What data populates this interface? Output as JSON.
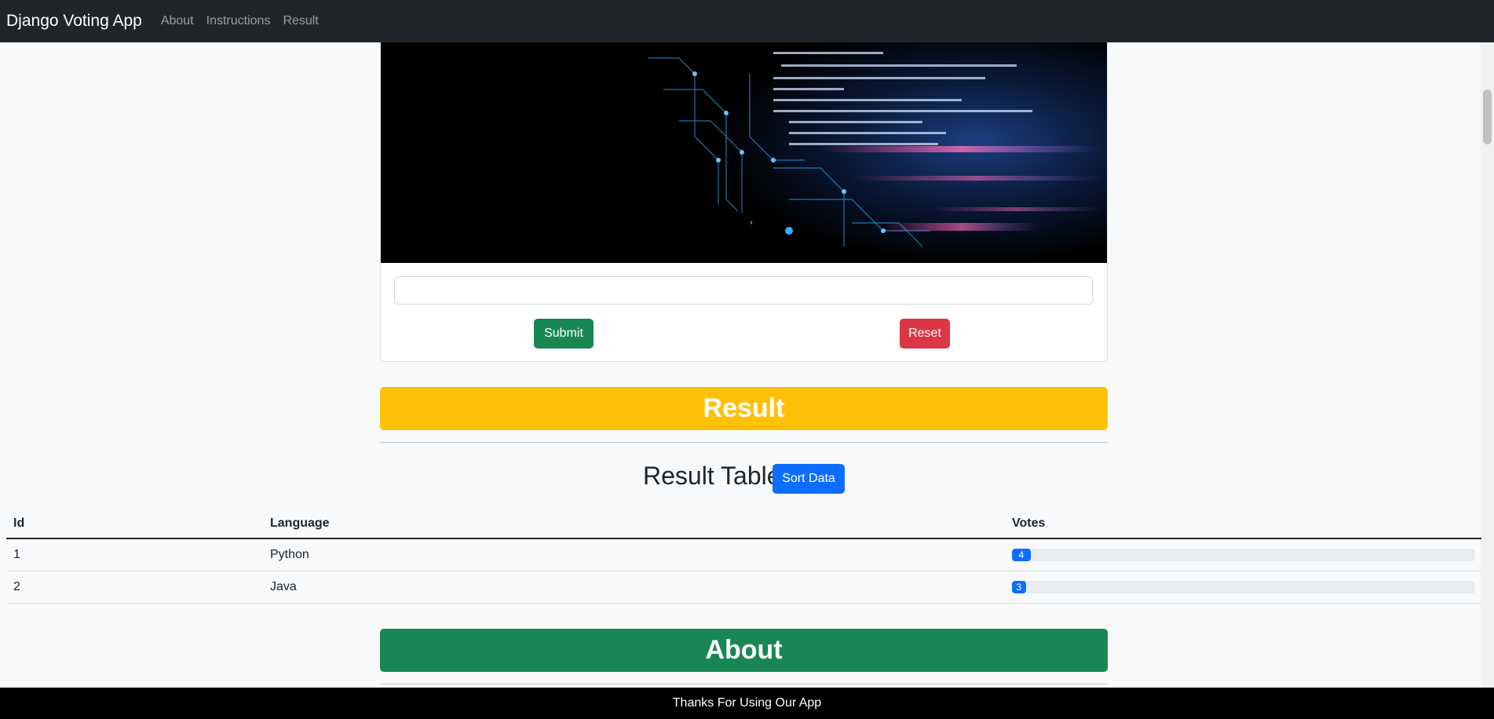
{
  "navbar": {
    "brand": "Django Voting App",
    "links": [
      "About",
      "Instructions",
      "Result"
    ]
  },
  "form": {
    "input_value": "",
    "submit_label": "Submit",
    "reset_label": "Reset"
  },
  "result_section": {
    "banner": "Result",
    "table_title": "Result Table",
    "sort_label": "Sort Data",
    "columns": [
      "Id",
      "Language",
      "Votes"
    ],
    "rows": [
      {
        "id": "1",
        "language": "Python",
        "votes": "4",
        "fill": 0.04
      },
      {
        "id": "2",
        "language": "Java",
        "votes": "3",
        "fill": 0.03
      }
    ]
  },
  "about_section": {
    "banner": "About"
  },
  "footer": {
    "text": "Thanks For Using Our App"
  },
  "colors": {
    "navbar": "#212529",
    "warning": "#ffc107",
    "success": "#198754",
    "danger": "#dc3545",
    "primary": "#0d6efd"
  }
}
